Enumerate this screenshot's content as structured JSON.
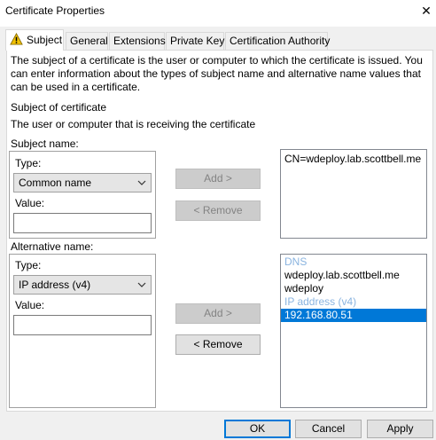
{
  "window": {
    "title": "Certificate Properties",
    "close_glyph": "✕"
  },
  "tabs": [
    {
      "label": "Subject",
      "active": true,
      "icon": "warning-icon"
    },
    {
      "label": "General",
      "active": false
    },
    {
      "label": "Extensions",
      "active": false
    },
    {
      "label": "Private Key",
      "active": false
    },
    {
      "label": "Certification Authority",
      "active": false
    }
  ],
  "intro": {
    "line1": "The subject of a certificate is the user or computer to which the certificate is issued. You",
    "line2": "can enter information about the types of subject name and alternative name values that",
    "line3": "can be used in a certificate."
  },
  "subject_section": {
    "heading": "Subject of certificate",
    "description": "The user or computer that is receiving the certificate"
  },
  "subject_name": {
    "label": "Subject name:",
    "type_label": "Type:",
    "type_value": "Common name",
    "value_label": "Value:",
    "value": "",
    "add_button": "Add >",
    "remove_button": "< Remove",
    "list": [
      "CN=wdeploy.lab.scottbell.me"
    ]
  },
  "alternative_name": {
    "label": "Alternative name:",
    "type_label": "Type:",
    "type_value": "IP address (v4)",
    "value_label": "Value:",
    "value": "",
    "add_button": "Add >",
    "remove_button": "< Remove",
    "list": [
      {
        "text": "DNS",
        "kind": "header"
      },
      {
        "text": "wdeploy.lab.scottbell.me",
        "kind": "item"
      },
      {
        "text": "wdeploy",
        "kind": "item"
      },
      {
        "text": "IP address (v4)",
        "kind": "header"
      },
      {
        "text": "192.168.80.51",
        "kind": "selected"
      }
    ]
  },
  "footer": {
    "ok": "OK",
    "cancel": "Cancel",
    "apply": "Apply"
  },
  "colors": {
    "accent": "#0078d7",
    "list_header": "#8ab4e0",
    "warning": "#f2c200"
  }
}
